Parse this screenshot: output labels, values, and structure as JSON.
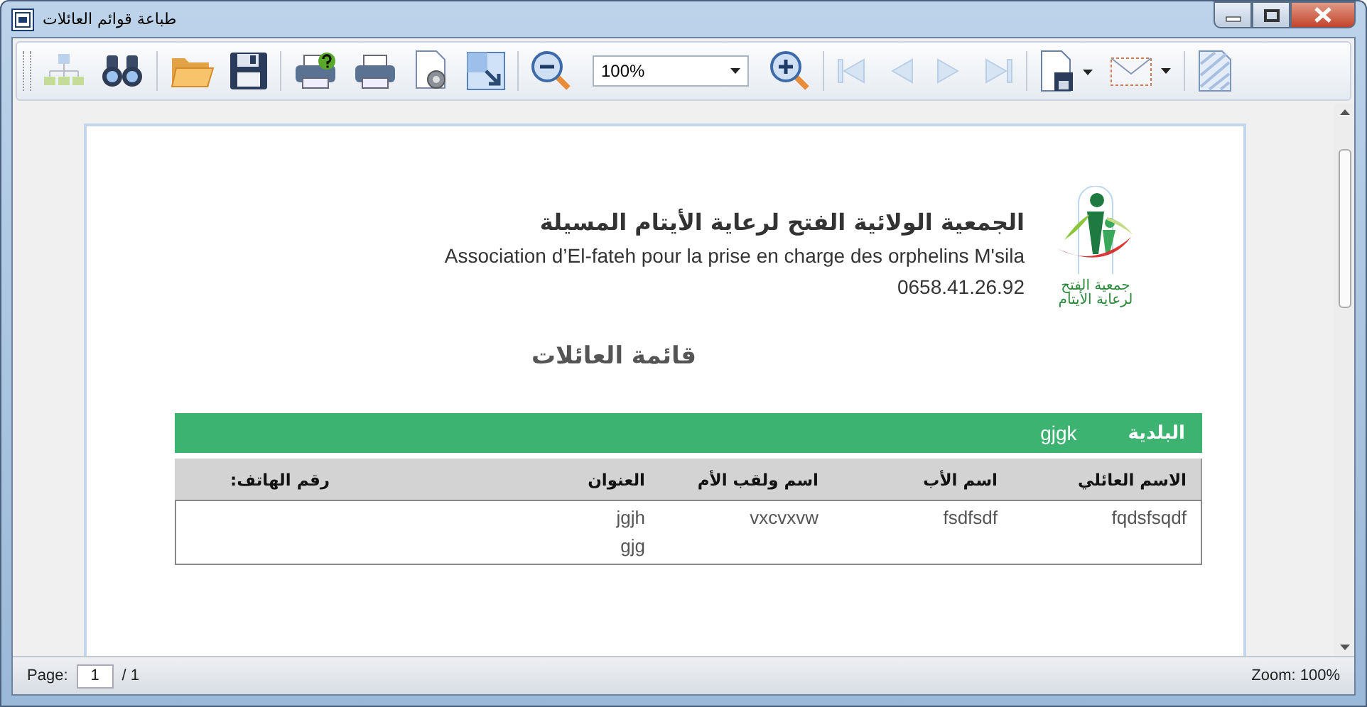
{
  "window": {
    "title": "طباعة قوائم العائلات"
  },
  "toolbar": [
    {
      "kind": "tree",
      "disabled": true
    },
    {
      "kind": "find",
      "disabled": false
    },
    {
      "kind": "sep"
    },
    {
      "kind": "open",
      "disabled": false
    },
    {
      "kind": "save",
      "disabled": false
    },
    {
      "kind": "sep"
    },
    {
      "kind": "print-help",
      "disabled": false
    },
    {
      "kind": "print",
      "disabled": false
    },
    {
      "kind": "page-setup",
      "disabled": false
    },
    {
      "kind": "scale",
      "disabled": false
    },
    {
      "kind": "sep"
    },
    {
      "kind": "zoom-out",
      "disabled": false
    },
    {
      "kind": "zoom-combo",
      "value": "100%"
    },
    {
      "kind": "zoom-in",
      "disabled": false
    },
    {
      "kind": "sep"
    },
    {
      "kind": "first",
      "disabled": true
    },
    {
      "kind": "prev",
      "disabled": true
    },
    {
      "kind": "next",
      "disabled": true
    },
    {
      "kind": "last",
      "disabled": true
    },
    {
      "kind": "sep"
    },
    {
      "kind": "export",
      "disabled": false
    },
    {
      "kind": "mail",
      "disabled": false
    },
    {
      "kind": "sep"
    },
    {
      "kind": "watermark",
      "disabled": false
    }
  ],
  "report": {
    "org_name_ar": "الجمعية الولائية الفتح لرعاية الأيتام المسيلة",
    "org_name_fr": "Association d’El-fateh pour la prise en charge des orphelins M'sila",
    "phone": "0658.41.26.92",
    "logo_text": "جمعية الفتح لرعاية الأيتام",
    "title": "قائمة العائلات",
    "group": {
      "label": "البلدية",
      "value": "gjgk"
    },
    "columns": [
      "الاسم العائلي",
      "اسم الأب",
      "اسم ولقب الأم",
      "العنوان",
      "رقم الهاتف:"
    ],
    "rows": [
      [
        "fqdsfsqdf",
        "fsdfsdf",
        "vxcvxvw",
        "jgjh\ngjg"
      ]
    ]
  },
  "status_bar": {
    "page_label": "Page:",
    "page": "1",
    "page_total": "/ 1",
    "zoom": "Zoom: 100%"
  }
}
